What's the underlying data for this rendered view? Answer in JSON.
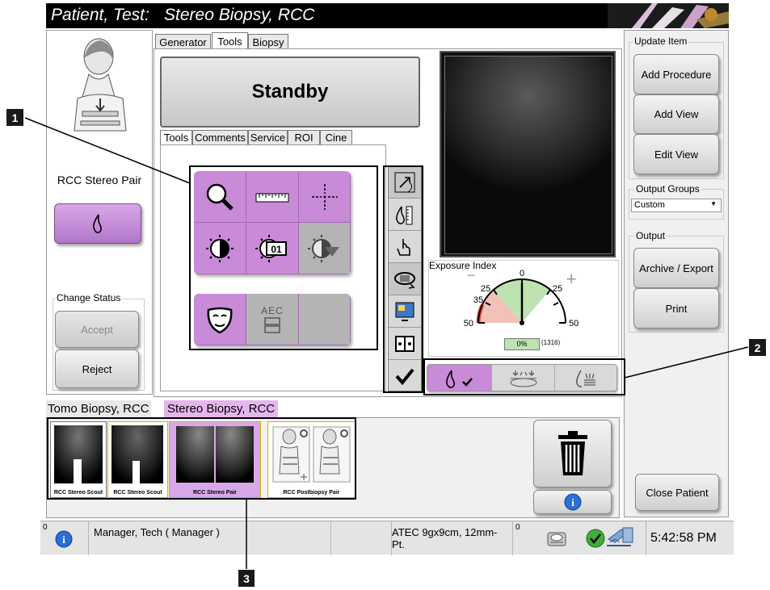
{
  "title": {
    "patient": "Patient, Test:",
    "procedure": "Stereo Biopsy, RCC"
  },
  "left_panel": {
    "view_label": "RCC Stereo Pair",
    "change_status": "Change Status",
    "accept": "Accept",
    "reject": "Reject"
  },
  "top_tabs": [
    "Generator",
    "Tools",
    "Biopsy"
  ],
  "standby": "Standby",
  "sub_tabs": [
    "Tools",
    "Comments",
    "Service",
    "ROI",
    "Cine"
  ],
  "tools": {
    "aec_label": "AEC",
    "window_number": "01"
  },
  "exposure": {
    "title": "Exposure Index",
    "ticks": [
      "0",
      "25",
      "25",
      "35",
      "50",
      "50"
    ],
    "percent": "0%",
    "raw": "(1316)",
    "minus": "−",
    "plus": "+"
  },
  "right_panel": {
    "update_item": "Update Item",
    "add_procedure": "Add Procedure",
    "add_view": "Add View",
    "edit_view": "Edit View",
    "output_groups": "Output Groups",
    "output_groups_value": "Custom",
    "output": "Output",
    "archive_export": "Archive / Export",
    "print": "Print",
    "close_patient": "Close Patient"
  },
  "procedure_tabs": [
    "Tomo Biopsy, RCC",
    "Stereo Biopsy, RCC"
  ],
  "thumbnails": [
    "RCC Stereo Scout",
    "RCC Stereo Scout",
    "RCC Stereo Pair",
    "RCC Postbiopsy Pair"
  ],
  "status_bar": {
    "count_left": "0",
    "user": "Manager, Tech ( Manager )",
    "device": "ATEC 9gx9cm, 12mm-Pt.",
    "count_right": "0",
    "time": "5:42:58 PM"
  },
  "callouts": [
    "1",
    "2",
    "3"
  ],
  "colors": {
    "title_bg": "#000000",
    "tool_purple": "#c98ad8",
    "gauge_green": "#bfe3b0",
    "gauge_red": "#e8453c"
  }
}
